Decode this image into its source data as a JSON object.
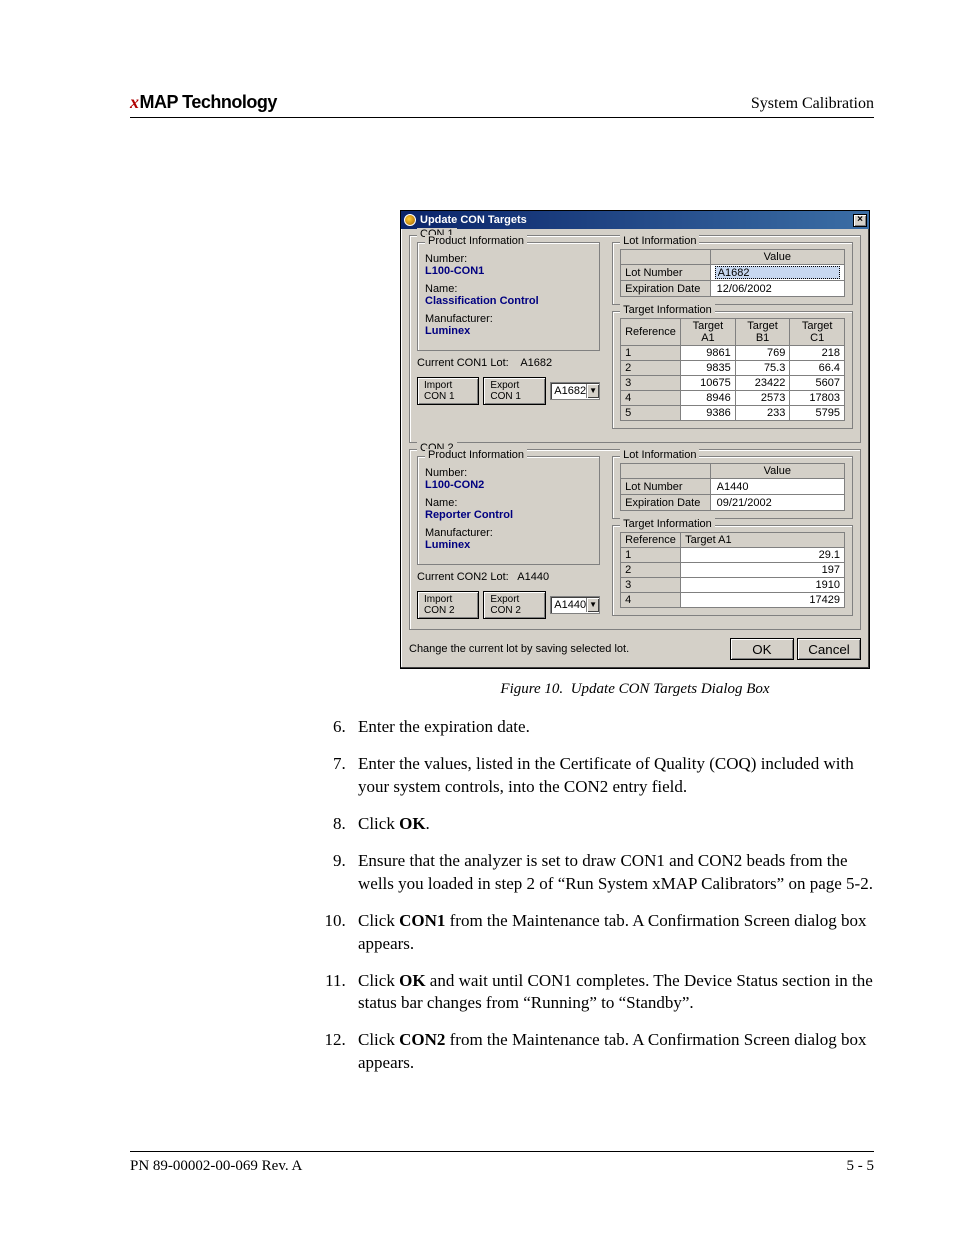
{
  "header": {
    "brand_x": "x",
    "brand_rest": "MAP Technology",
    "section": "System Calibration"
  },
  "footer": {
    "left": "PN 89-00002-00-069 Rev. A",
    "right": "5 - 5"
  },
  "figure": {
    "label": "Figure 10.",
    "caption": "Update CON Targets Dialog Box"
  },
  "dialog": {
    "title": "Update CON Targets",
    "close_glyph": "×",
    "note": "Change the current lot by saving selected lot.",
    "ok": "OK",
    "cancel": "Cancel",
    "con1": {
      "group": "CON 1",
      "prodinfo_cap": "Product Information",
      "number_lbl": "Number:",
      "number_val": "L100-CON1",
      "name_lbl": "Name:",
      "name_val": "Classification Control",
      "manuf_lbl": "Manufacturer:",
      "manuf_val": "Luminex",
      "current_lot_lbl": "Current CON1 Lot:",
      "current_lot_val": "A1682",
      "import_btn": "Import CON 1",
      "export_btn": "Export CON 1",
      "combo_val": "A1682",
      "lotinfo_cap": "Lot Information",
      "lot_value_h": "Value",
      "lot_number_lbl": "Lot Number",
      "lot_number_val": "A1682",
      "exp_lbl": "Expiration Date",
      "exp_val": "12/06/2002",
      "tgt_cap": "Target Information",
      "tgt_headers": [
        "Reference",
        "Target A1",
        "Target B1",
        "Target C1"
      ],
      "tgt_rows": [
        {
          "ref": "1",
          "a": "9861",
          "b": "769",
          "c": "218"
        },
        {
          "ref": "2",
          "a": "9835",
          "b": "75.3",
          "c": "66.4"
        },
        {
          "ref": "3",
          "a": "10675",
          "b": "23422",
          "c": "5607"
        },
        {
          "ref": "4",
          "a": "8946",
          "b": "2573",
          "c": "17803"
        },
        {
          "ref": "5",
          "a": "9386",
          "b": "233",
          "c": "5795"
        }
      ]
    },
    "con2": {
      "group": "CON 2",
      "prodinfo_cap": "Product Information",
      "number_lbl": "Number:",
      "number_val": "L100-CON2",
      "name_lbl": "Name:",
      "name_val": "Reporter Control",
      "manuf_lbl": "Manufacturer:",
      "manuf_val": "Luminex",
      "current_lot_lbl": "Current CON2 Lot:",
      "current_lot_val": "A1440",
      "import_btn": "Import CON 2",
      "export_btn": "Export CON 2",
      "combo_val": "A1440",
      "lotinfo_cap": "Lot Information",
      "lot_value_h": "Value",
      "lot_number_lbl": "Lot Number",
      "lot_number_val": "A1440",
      "exp_lbl": "Expiration Date",
      "exp_val": "09/21/2002",
      "tgt_cap": "Target Information",
      "tgt_headers": [
        "Reference",
        "Target A1"
      ],
      "tgt_rows": [
        {
          "ref": "1",
          "a": "29.1"
        },
        {
          "ref": "2",
          "a": "197"
        },
        {
          "ref": "3",
          "a": "1910"
        },
        {
          "ref": "4",
          "a": "17429"
        }
      ]
    }
  },
  "steps": {
    "s6": "Enter the expiration date.",
    "s7": "Enter the values, listed in the Certificate of Quality (COQ) included with your system controls, into the CON2 entry field.",
    "s8a": "Click ",
    "s8b": "OK",
    "s8c": ".",
    "s9": "Ensure that the analyzer is set to draw CON1 and CON2 beads from the wells you loaded in step 2 of “Run System xMAP Calibrators” on page 5-2.",
    "s10a": "Click ",
    "s10b": "CON1",
    "s10c": " from the Maintenance tab. A Confirmation Screen dialog box appears.",
    "s11a": "Click ",
    "s11b": "OK",
    "s11c": " and wait until CON1 completes. The Device Status section in the status bar changes from “Running” to “Standby”.",
    "s12a": "Click ",
    "s12b": "CON2",
    "s12c": " from the Maintenance tab. A Confirmation Screen dialog box appears."
  }
}
